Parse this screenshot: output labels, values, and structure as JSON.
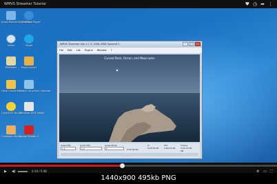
{
  "player": {
    "title": "WMVS Streamer Tutorial",
    "progress": 0.44
  },
  "desktop": {
    "icons": [
      {
        "label": "Audio Record Edit Toolbox",
        "icon": "audio-record-icon",
        "color": "#7fb6e8"
      },
      {
        "label": "QuickTime Player",
        "icon": "quicktime-icon",
        "color": "#3a8cd8"
      },
      {
        "label": "Safari",
        "icon": "safari-icon",
        "color": "#d9e4ef"
      },
      {
        "label": "Skype",
        "icon": "skype-icon",
        "color": "#21a7e6"
      },
      {
        "label": "FileMaker",
        "icon": "filemaker-icon",
        "color": "#e8d6a0"
      },
      {
        "label": "EasyConvert",
        "icon": "easyconvert-icon",
        "color": "#e6b04a"
      },
      {
        "label": "Hash Converter",
        "icon": "hash-icon",
        "color": "#f0c24a"
      },
      {
        "label": "Media Converter Ultimate",
        "icon": "media-converter-icon",
        "color": "#8ec2e8"
      },
      {
        "label": "CyberLink YouCam",
        "icon": "youcam-icon",
        "color": "#f3d03c"
      },
      {
        "label": "Windows DVD Maker",
        "icon": "dvd-maker-icon",
        "color": "#e6e6e6"
      },
      {
        "label": "Camtasia Studio",
        "icon": "camtasia-icon",
        "color": "#e8b060"
      },
      {
        "label": "Adobe Reader X",
        "icon": "adobe-reader-icon",
        "color": "#d42020"
      }
    ]
  },
  "window": {
    "title": "WMVS Streamer Lite 1.2  © 2006-2008 Squared 5",
    "menu": [
      "File",
      "Edit",
      "List",
      "Engine",
      "Window",
      "?"
    ],
    "video_title": "Curved Rock, Ocean, and Moon.wmv",
    "controls": {
      "video_fmt_label": "Video FEC",
      "audio_fmt_label": "Audio FEC",
      "audio_mode_label": "Audio Mode",
      "time_value": "0:00:00:00",
      "in_label": "In",
      "in_value": "0:00:00:00",
      "out_label": "Out",
      "out_value": "0:00:14:00",
      "timing_label": "Timing",
      "timing_value": "0:00:14:00",
      "ab_value": "AB"
    }
  },
  "playback": {
    "elapsed": "2:34",
    "duration": "5:48",
    "time_text": "2:34 / 5:48"
  },
  "caption": "1440x900 495kb PNG"
}
